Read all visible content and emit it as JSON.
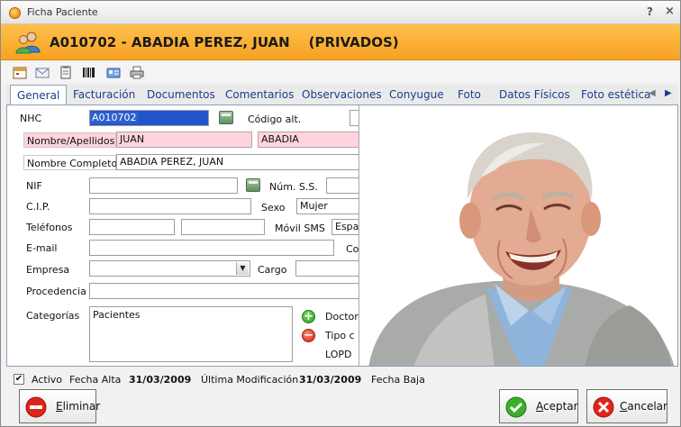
{
  "window": {
    "title": "Ficha Paciente",
    "help": "?",
    "close": "×"
  },
  "header": {
    "patient_title": "A010702 - ABADIA PEREZ, JUAN    (PRIVADOS)"
  },
  "tabs": [
    {
      "label": "General",
      "active": true
    },
    {
      "label": "Facturación"
    },
    {
      "label": "Documentos"
    },
    {
      "label": "Comentarios"
    },
    {
      "label": "Observaciones"
    },
    {
      "label": "Conyugue"
    },
    {
      "label": "Foto"
    },
    {
      "label": "Datos Físicos"
    },
    {
      "label": "Foto estética"
    }
  ],
  "form": {
    "nhc_label": "NHC",
    "nhc_value": "A010702",
    "codigo_alt_label": "Código alt.",
    "nombre_apellidos_label": "Nombre/Apellidos",
    "nombre_value": "JUAN",
    "apellido1_value": "ABADIA",
    "nombre_completo_label": "Nombre Completo",
    "nombre_completo_value": "ABADIA PEREZ, JUAN",
    "nif_label": "NIF",
    "num_ss_label": "Núm. S.S.",
    "cip_label": "C.I.P.",
    "sexo_label": "Sexo",
    "sexo_value": "Mujer",
    "telefonos_label": "Teléfonos",
    "movil_sms_label": "Móvil SMS",
    "movil_sms_value": "Espa",
    "email_label": "E-mail",
    "co_label": "Co",
    "empresa_label": "Empresa",
    "cargo_label": "Cargo",
    "procedencia_label": "Procedencia",
    "categorias_label": "Categorías",
    "categorias_value": "Pacientes",
    "doctor_label": "Doctor",
    "tipo_label": "Tipo c",
    "lopd_label": "LOPD"
  },
  "status": {
    "activo_label": "Activo",
    "activo_checked": "✔",
    "fecha_alta_label": "Fecha Alta",
    "fecha_alta_value": "31/03/2009",
    "ultima_mod_label": "Última Modificación",
    "ultima_mod_value": "31/03/2009",
    "fecha_baja_label": "Fecha Baja"
  },
  "buttons": {
    "eliminar_first": "E",
    "eliminar_rest": "liminar",
    "aceptar_first": "A",
    "aceptar_rest": "ceptar",
    "cancelar_first": "C",
    "cancelar_rest": "ancelar"
  },
  "colors": {
    "header": "#f7a221",
    "required_field": "#ffd4dc",
    "tab_text": "#1b3c8c"
  }
}
